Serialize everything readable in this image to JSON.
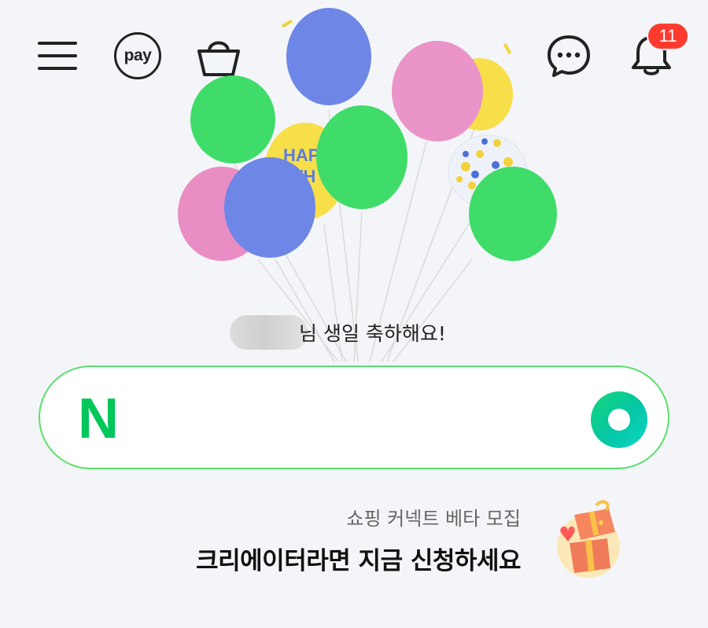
{
  "header": {
    "menu_icon": "hamburger-menu-icon",
    "pay_label": "pay",
    "cart_icon": "shopping-bag-icon",
    "chat_icon": "chat-bubble-icon",
    "bell_icon": "bell-icon",
    "notification_count": "11"
  },
  "banner": {
    "greeting_suffix": "님 생일 축하해요!"
  },
  "search": {
    "logo_letter": "N",
    "value": "",
    "placeholder": ""
  },
  "promo": {
    "subtitle": "쇼핑 커넥트 베타 모집",
    "title": "크리에이터라면 지금 신청하세요"
  },
  "colors": {
    "brand_green": "#03c75a",
    "search_border": "#5be06c",
    "badge_red": "#ff3b30",
    "background": "#f3f5f8"
  }
}
